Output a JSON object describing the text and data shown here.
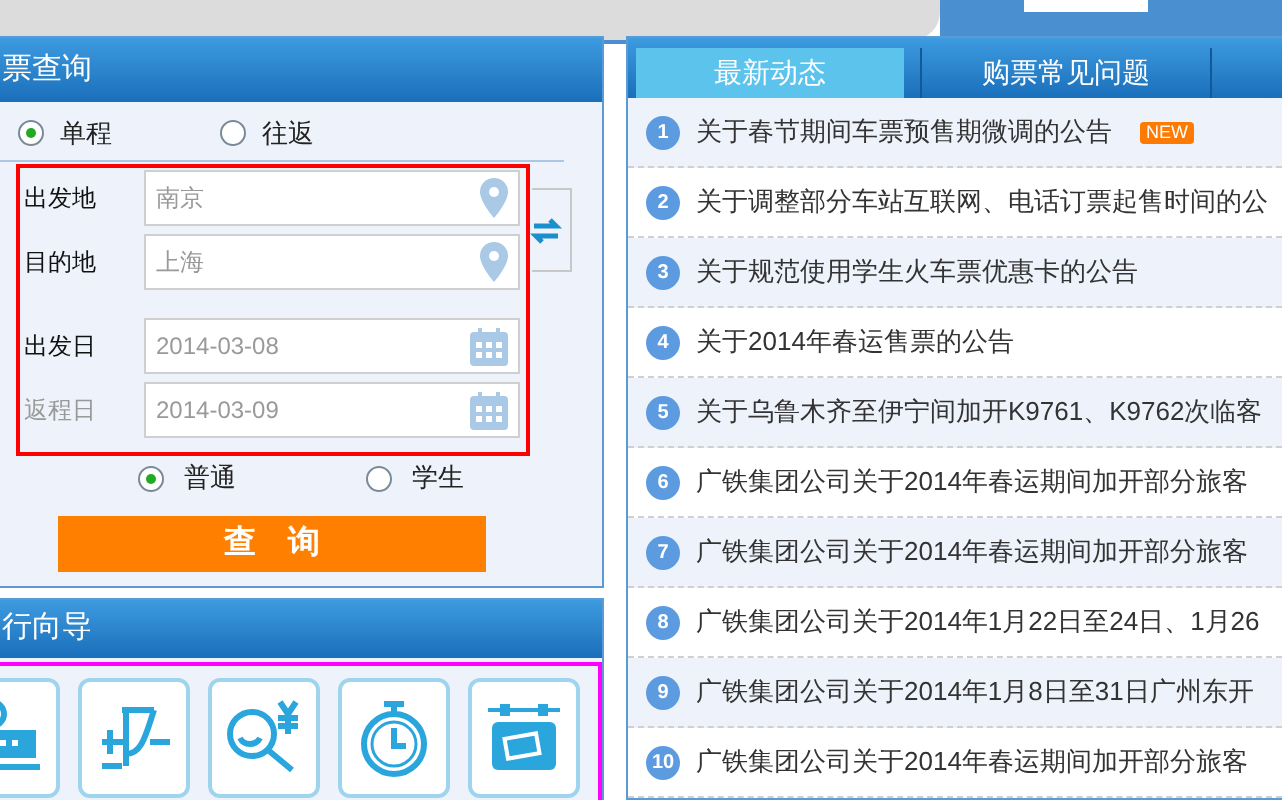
{
  "ticket_search": {
    "title": "票查询",
    "trip_types": [
      {
        "label": "单程",
        "selected": true
      },
      {
        "label": "往返",
        "selected": false
      }
    ],
    "fields": [
      {
        "label": "出发地",
        "value": "南京",
        "kind": "place",
        "disabled": false
      },
      {
        "label": "目的地",
        "value": "上海",
        "kind": "place",
        "disabled": false
      },
      {
        "label": "出发日",
        "value": "2014-03-08",
        "kind": "date",
        "disabled": false
      },
      {
        "label": "返程日",
        "value": "2014-03-09",
        "kind": "date",
        "disabled": true
      }
    ],
    "passenger_types": [
      {
        "label": "普通",
        "selected": true
      },
      {
        "label": "学生",
        "selected": false
      }
    ],
    "search_button": "查　询"
  },
  "travel_guide": {
    "title": "行向导",
    "tiles": [
      {
        "kind": "train"
      },
      {
        "kind": "track"
      },
      {
        "kind": "fare"
      },
      {
        "kind": "clock"
      },
      {
        "kind": "ticket"
      }
    ]
  },
  "tabs": [
    {
      "label": "最新动态",
      "selected": true
    },
    {
      "label": "购票常见问题",
      "selected": false
    }
  ],
  "news": [
    {
      "number": "1",
      "title": "关于春节期间车票预售期微调的公告",
      "badge": "NEW"
    },
    {
      "number": "2",
      "title": "关于调整部分车站互联网、电话订票起售时间的公"
    },
    {
      "number": "3",
      "title": "关于规范使用学生火车票优惠卡的公告"
    },
    {
      "number": "4",
      "title": "关于2014年春运售票的公告"
    },
    {
      "number": "5",
      "title": "关于乌鲁木齐至伊宁间加开K9761、K9762次临客"
    },
    {
      "number": "6",
      "title": "广铁集团公司关于2014年春运期间加开部分旅客"
    },
    {
      "number": "7",
      "title": "广铁集团公司关于2014年春运期间加开部分旅客"
    },
    {
      "number": "8",
      "title": "广铁集团公司关于2014年1月22日至24日、1月26"
    },
    {
      "number": "9",
      "title": "广铁集团公司关于2014年1月8日至31日广州东开"
    },
    {
      "number": "10",
      "title": "广铁集团公司关于2014年春运期间加开部分旅客"
    }
  ]
}
